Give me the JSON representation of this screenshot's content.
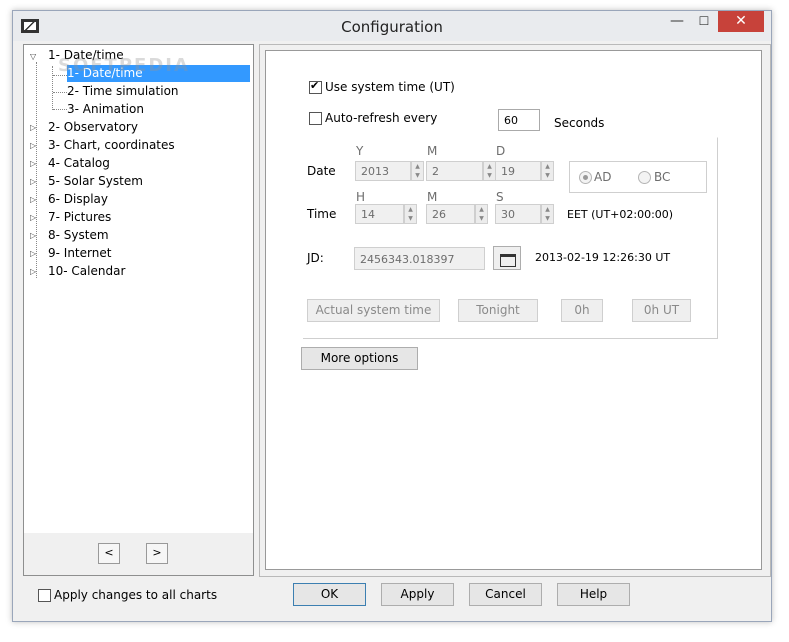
{
  "window": {
    "title": "Configuration",
    "min_icon": "—",
    "max_icon": "☐",
    "close_icon": "✕"
  },
  "tree": {
    "items": [
      {
        "label": "1- Date/time",
        "expanded": true
      },
      {
        "label": "1- Date/time",
        "selected": true
      },
      {
        "label": "2- Time simulation"
      },
      {
        "label": "3- Animation"
      },
      {
        "label": "2- Observatory"
      },
      {
        "label": "3- Chart, coordinates"
      },
      {
        "label": "4- Catalog"
      },
      {
        "label": "5- Solar System"
      },
      {
        "label": "6- Display"
      },
      {
        "label": "7- Pictures"
      },
      {
        "label": "8- System"
      },
      {
        "label": "9- Internet"
      },
      {
        "label": "10- Calendar"
      }
    ],
    "twisty_open": "▽",
    "twisty_closed": "▷",
    "prev_label": "<",
    "next_label": ">"
  },
  "watermark": "SOFTPEDIA",
  "datetime": {
    "use_system_time_label": "Use system time (UT)",
    "use_system_time_checked": true,
    "auto_refresh_label": "Auto-refresh every",
    "auto_refresh_checked": false,
    "auto_refresh_value": "60",
    "seconds_label": "Seconds",
    "date_label": "Date",
    "y_label": "Y",
    "m_label": "M",
    "d_label": "D",
    "year": "2013",
    "month": "2",
    "day": "19",
    "time_label": "Time",
    "h_label": "H",
    "min_label": "M",
    "s_label": "S",
    "hour": "14",
    "minute": "26",
    "second": "30",
    "timezone": "EET (UT+02:00:00)",
    "era_ad": "AD",
    "era_bc": "BC",
    "era_selected": "AD",
    "jd_label": "JD:",
    "jd_value": "2456343.018397",
    "jd_datetime": "2013-02-19 12:26:30 UT",
    "btn_actual": "Actual system time",
    "btn_tonight": "Tonight",
    "btn_0h": "0h",
    "btn_0hut": "0h UT",
    "more_options": "More options"
  },
  "footer": {
    "apply_all_label": "Apply changes to all charts",
    "apply_all_checked": false,
    "ok": "OK",
    "apply": "Apply",
    "cancel": "Cancel",
    "help": "Help"
  }
}
